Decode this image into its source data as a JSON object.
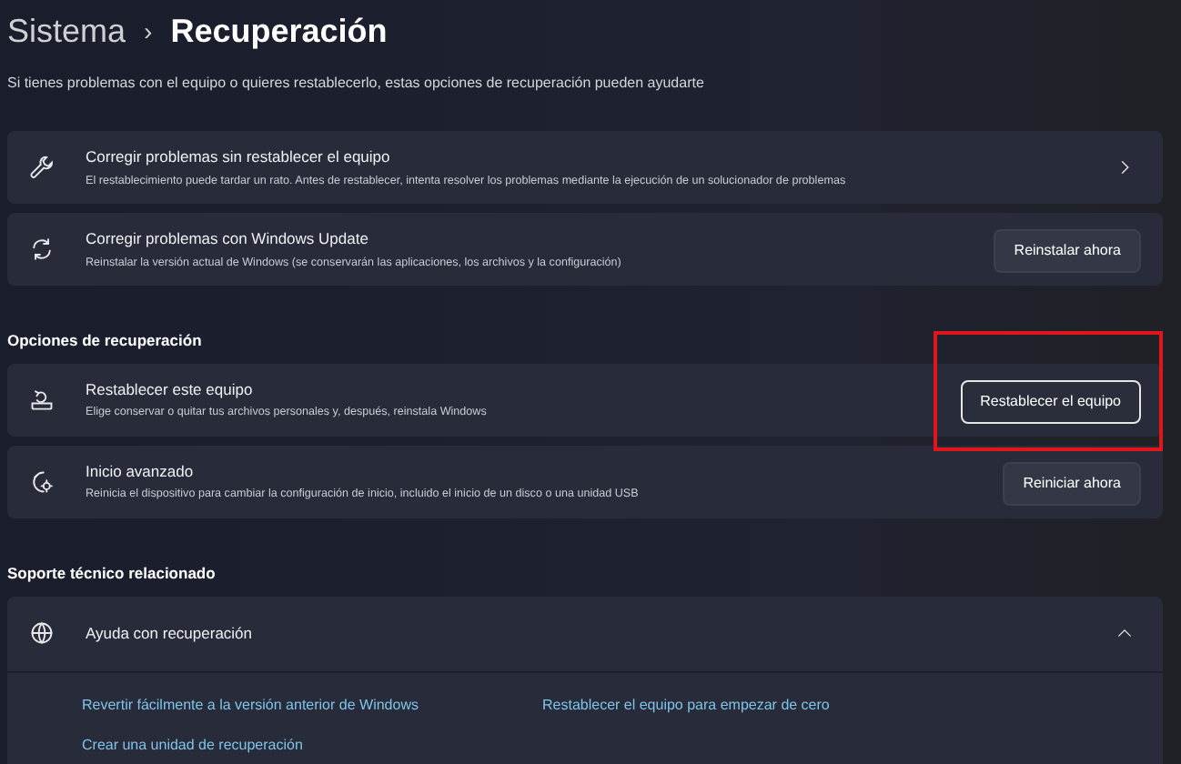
{
  "breadcrumb": {
    "parent": "Sistema",
    "separator": "›",
    "current": "Recuperación"
  },
  "subtitle": "Si tienes problemas con el equipo o quieres restablecerlo, estas opciones de recuperación pueden ayudarte",
  "sections": [
    {
      "items": [
        {
          "title": "Corregir problemas sin restablecer el equipo",
          "description": "El restablecimiento puede tardar un rato. Antes de restablecer, intenta resolver los problemas mediante la ejecución de un solucionador de problemas",
          "action": {
            "kind": "chevron"
          }
        },
        {
          "title": "Corregir problemas con Windows Update",
          "description": "Reinstalar la versión actual de Windows (se conservarán las aplicaciones, los archivos y la configuración)",
          "action": {
            "kind": "button",
            "label": "Reinstalar ahora",
            "highlighted": false
          }
        }
      ]
    },
    {
      "heading": "Opciones de recuperación",
      "items": [
        {
          "title": "Restablecer este equipo",
          "description": "Elige conservar o quitar tus archivos personales y, después, reinstala Windows",
          "action": {
            "kind": "button",
            "label": "Restablecer el equipo",
            "highlighted": true
          }
        },
        {
          "title": "Inicio avanzado",
          "description": "Reinicia el dispositivo para cambiar la configuración de inicio, incluido el inicio de un disco o una unidad USB",
          "action": {
            "kind": "button",
            "label": "Reiniciar ahora",
            "highlighted": false
          }
        }
      ]
    }
  ],
  "support": {
    "heading": "Soporte técnico relacionado",
    "title": "Ayuda con recuperación",
    "expanded": true,
    "links": [
      "Revertir fácilmente a la versión anterior de Windows",
      "Restablecer el equipo para empezar de cero",
      "Crear una unidad de recuperación"
    ]
  }
}
